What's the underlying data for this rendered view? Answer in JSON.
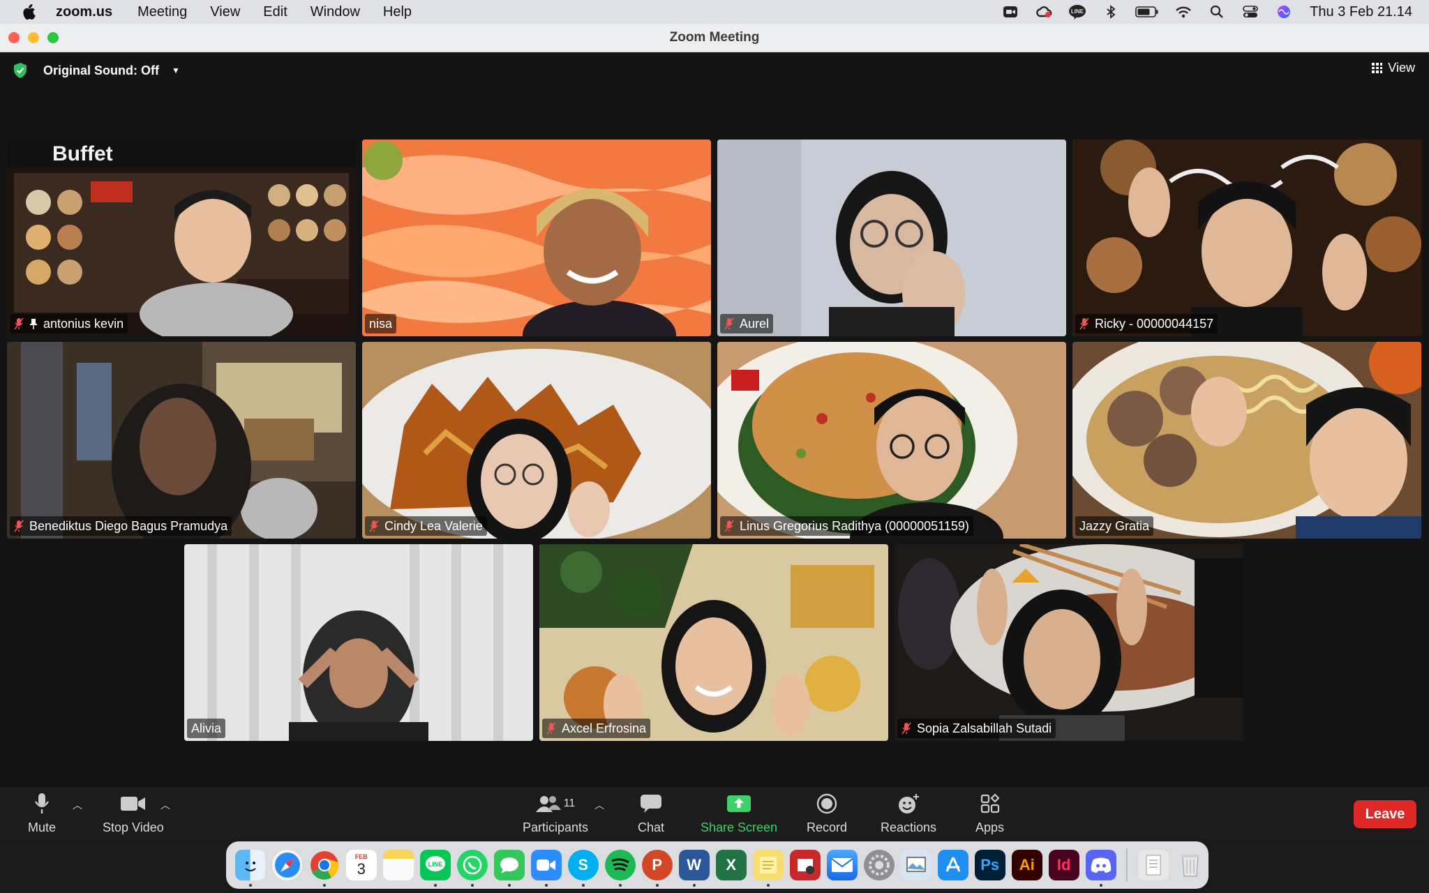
{
  "menubar": {
    "app_name": "zoom.us",
    "menus": [
      "Meeting",
      "View",
      "Edit",
      "Window",
      "Help"
    ],
    "status_icons": [
      "zoom-icon",
      "creative-cloud-icon",
      "line-icon",
      "bluetooth-icon",
      "battery-icon",
      "wifi-icon",
      "spotlight-search-icon",
      "control-center-icon",
      "siri-icon"
    ],
    "clock": "Thu 3 Feb  21.14"
  },
  "window": {
    "title": "Zoom Meeting"
  },
  "topbar": {
    "original_sound": "Original Sound: Off",
    "view_label": "View"
  },
  "participants": [
    {
      "name": "antonius kevin",
      "muted": true,
      "pinned": true,
      "active": false
    },
    {
      "name": "nisa",
      "muted": false,
      "pinned": false,
      "active": false
    },
    {
      "name": "Aurel",
      "muted": true,
      "pinned": false,
      "active": false
    },
    {
      "name": "Ricky - 00000044157",
      "muted": true,
      "pinned": false,
      "active": true
    },
    {
      "name": "Benediktus Diego Bagus Pramudya",
      "muted": true,
      "pinned": false,
      "active": false
    },
    {
      "name": "Cindy Lea Valerie",
      "muted": true,
      "pinned": false,
      "active": false
    },
    {
      "name": "Linus Gregorius Radithya (00000051159)",
      "muted": true,
      "pinned": false,
      "active": false
    },
    {
      "name": "Jazzy Gratia",
      "muted": false,
      "pinned": false,
      "active": false
    },
    {
      "name": "Alivia",
      "muted": false,
      "pinned": false,
      "active": false
    },
    {
      "name": "Axcel Erfrosina",
      "muted": true,
      "pinned": false,
      "active": false
    },
    {
      "name": "Sopia Zalsabillah Sutadi",
      "muted": true,
      "pinned": false,
      "active": false
    }
  ],
  "tile_texts": {
    "buffet_sign": "Buffet"
  },
  "toolbar": {
    "mute": "Mute",
    "stop_video": "Stop Video",
    "participants": "Participants",
    "participants_count": "11",
    "chat": "Chat",
    "share_screen": "Share Screen",
    "record": "Record",
    "reactions": "Reactions",
    "apps": "Apps",
    "leave": "Leave"
  },
  "dock": {
    "calendar_month": "FEB",
    "calendar_day": "3",
    "apps": [
      "finder-icon",
      "safari-icon",
      "chrome-icon",
      "calendar-icon",
      "notes-icon",
      "line-icon",
      "whatsapp-icon",
      "messages-icon",
      "zoom-icon",
      "skype-icon",
      "spotify-icon",
      "powerpoint-icon",
      "word-icon",
      "excel-icon",
      "stickies-icon",
      "photo-booth-icon",
      "mail-icon",
      "system-preferences-icon",
      "preview-icon",
      "app-store-icon",
      "photoshop-icon",
      "illustrator-icon",
      "indesign-icon",
      "discord-icon",
      "documents-folder-icon",
      "trash-icon"
    ],
    "ps_label": "Ps",
    "ai_label": "Ai",
    "id_label": "Id"
  },
  "colors": {
    "active_speaker": "#3fd36c",
    "leave": "#e02828",
    "share": "#3ed16a"
  }
}
